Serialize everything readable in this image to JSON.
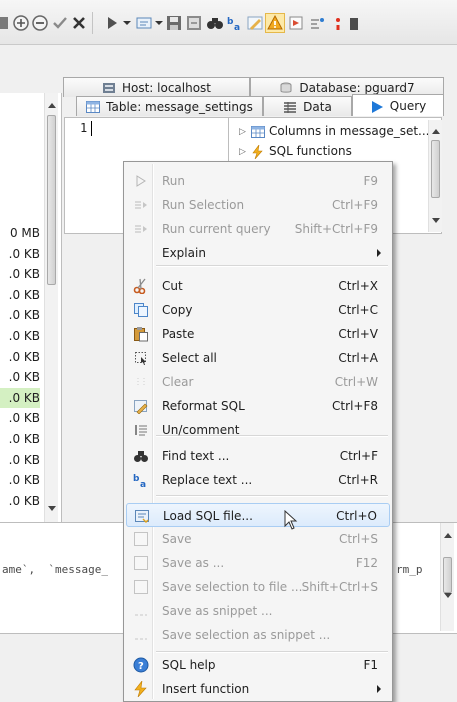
{
  "tabs": {
    "host_label": "Host: localhost",
    "database_label": "Database: pguard7",
    "table_label": "Table: message_settings",
    "data_label": "Data",
    "query_label": "Query"
  },
  "left_panel": {
    "sizes": [
      "0 MB",
      ".0 KB",
      ".0 KB",
      ".0 KB",
      ".0 KB",
      ".0 KB",
      ".0 KB",
      ".0 KB",
      ".0 KB",
      ".0 KB",
      ".0 KB",
      ".0 KB",
      ".0 KB",
      ".0 KB"
    ]
  },
  "editor": {
    "line_number": "1"
  },
  "helper_tree": {
    "items": [
      {
        "label": "Columns in message_set..."
      },
      {
        "label": "SQL functions"
      }
    ]
  },
  "sql_panel": {
    "left_text": "ame`,  `message_",
    "right_text": "rm_p"
  },
  "context_menu": {
    "items": [
      {
        "label": "Run",
        "shortcut": "F9",
        "enabled": false,
        "icon": "run-icon"
      },
      {
        "label": "Run Selection",
        "shortcut": "Ctrl+F9",
        "enabled": false,
        "icon": "run-selection-icon"
      },
      {
        "label": "Run current query",
        "shortcut": "Shift+Ctrl+F9",
        "enabled": false,
        "icon": "run-current-icon"
      },
      {
        "label": "Explain",
        "shortcut": "",
        "enabled": true,
        "submenu": true
      },
      {
        "label": "Cut",
        "shortcut": "Ctrl+X",
        "enabled": true,
        "icon": "scissors-icon"
      },
      {
        "label": "Copy",
        "shortcut": "Ctrl+C",
        "enabled": true,
        "icon": "copy-icon"
      },
      {
        "label": "Paste",
        "shortcut": "Ctrl+V",
        "enabled": true,
        "icon": "paste-icon"
      },
      {
        "label": "Select all",
        "shortcut": "Ctrl+A",
        "enabled": true,
        "icon": "select-all-icon"
      },
      {
        "label": "Clear",
        "shortcut": "Ctrl+W",
        "enabled": false,
        "icon": "clear-icon"
      },
      {
        "label": "Reformat SQL",
        "shortcut": "Ctrl+F8",
        "enabled": true,
        "icon": "reformat-icon"
      },
      {
        "label": "Un/comment",
        "shortcut": "",
        "enabled": true,
        "icon": "comment-icon"
      },
      {
        "label": "Find text ...",
        "shortcut": "Ctrl+F",
        "enabled": true,
        "icon": "binoculars-icon"
      },
      {
        "label": "Replace text ...",
        "shortcut": "Ctrl+R",
        "enabled": true,
        "icon": "replace-icon"
      },
      {
        "label": "Load SQL file...",
        "shortcut": "Ctrl+O",
        "enabled": true,
        "icon": "open-file-icon",
        "highlighted": true
      },
      {
        "label": "Save",
        "shortcut": "Ctrl+S",
        "enabled": false,
        "icon": "save-icon"
      },
      {
        "label": "Save as ...",
        "shortcut": "F12",
        "enabled": false,
        "icon": "save-as-icon"
      },
      {
        "label": "Save selection to file ...",
        "shortcut": "Shift+Ctrl+S",
        "enabled": false,
        "icon": "save-selection-icon"
      },
      {
        "label": "Save as snippet ...",
        "shortcut": "",
        "enabled": false,
        "icon": "snippet-icon"
      },
      {
        "label": "Save selection as snippet ...",
        "shortcut": "",
        "enabled": false,
        "icon": "snippet-selection-icon"
      },
      {
        "label": "SQL help",
        "shortcut": "F1",
        "enabled": true,
        "icon": "help-icon"
      },
      {
        "label": "Insert function",
        "shortcut": "",
        "enabled": true,
        "icon": "lightning-icon",
        "submenu": true
      }
    ]
  },
  "colors": {
    "menu_highlight": "#dcebfc",
    "size_highlight": "#d4f0c2",
    "query_tab_arrow": "#1e78d8"
  }
}
